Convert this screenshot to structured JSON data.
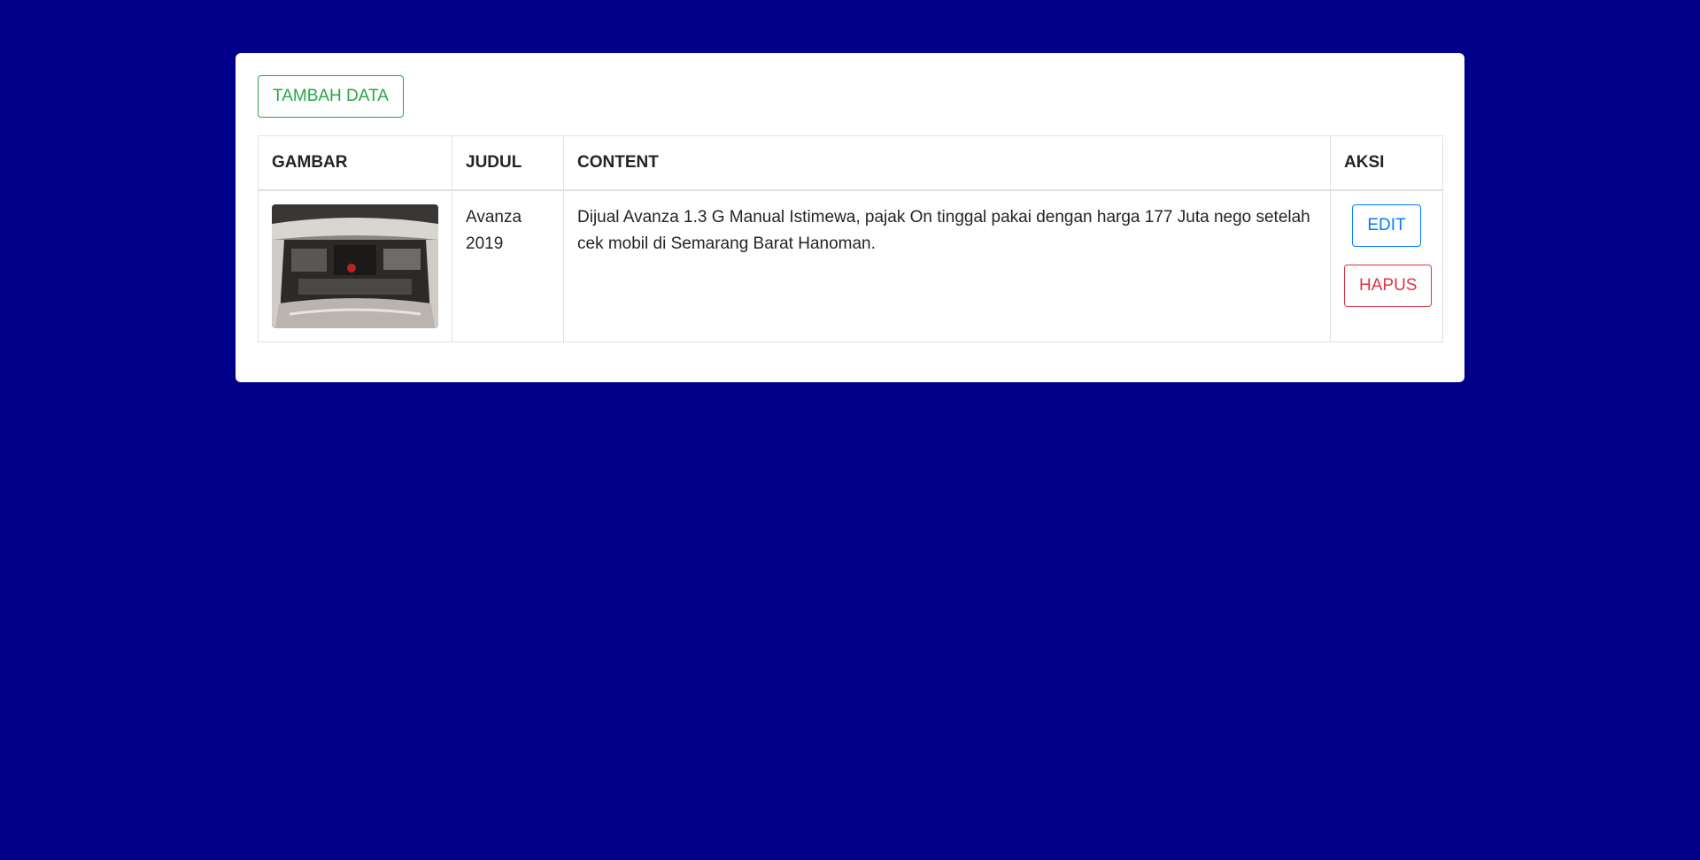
{
  "toolbar": {
    "add_label": "TAMBAH DATA"
  },
  "table": {
    "headers": [
      "GAMBAR",
      "JUDUL",
      "CONTENT",
      "AKSI"
    ],
    "rows": [
      {
        "image_icon": "car-engine-photo",
        "title": "Avanza 2019",
        "content": "Dijual Avanza 1.3 G Manual Istimewa, pajak On tinggal pakai dengan harga 177 Juta nego setelah cek mobil di Semarang Barat Hanoman.",
        "edit_label": "EDIT",
        "delete_label": "HAPUS"
      }
    ]
  },
  "colors": {
    "background": "#00008b",
    "success": "#28a745",
    "primary": "#007bff",
    "danger": "#dc3545"
  }
}
